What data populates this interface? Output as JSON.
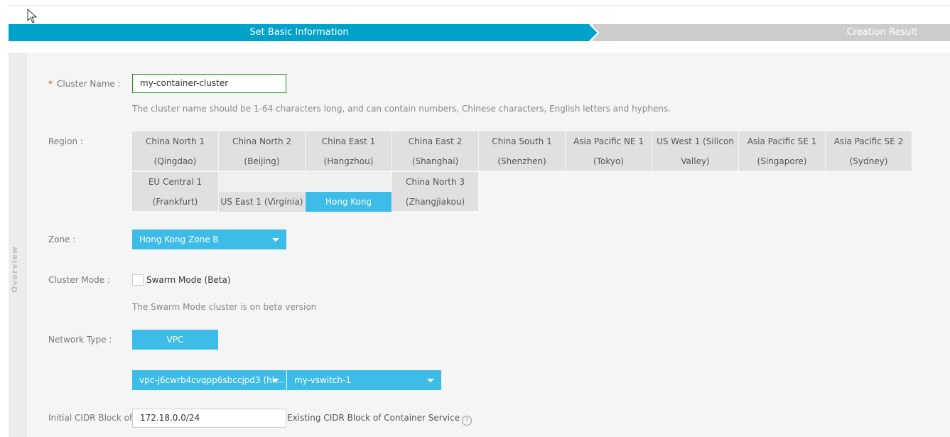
{
  "wizard": {
    "steps": [
      {
        "label": "Set Basic Information",
        "active": true
      },
      {
        "label": "Creation Result",
        "active": false
      }
    ]
  },
  "side_panel": {
    "label": "Overview"
  },
  "cluster_name": {
    "label": "Cluster Name :",
    "required_mark": "*",
    "value": "my-container-cluster",
    "hint": "The cluster name should be 1-64 characters long, and can contain numbers, Chinese characters, English letters and hyphens."
  },
  "region": {
    "label": "Region :",
    "options": [
      {
        "line1": "China North 1",
        "line2": "(Qingdao)"
      },
      {
        "line1": "China North 2",
        "line2": "(Beijing)"
      },
      {
        "line1": "China East 1",
        "line2": "(Hangzhou)"
      },
      {
        "line1": "China East 2",
        "line2": "(Shanghai)"
      },
      {
        "line1": "China South 1",
        "line2": "(Shenzhen)"
      },
      {
        "line1": "Asia Pacific NE 1",
        "line2": "(Tokyo)"
      },
      {
        "line1": "US West 1 (Silicon",
        "line2": "Valley)"
      },
      {
        "line1": "Asia Pacific SE 1",
        "line2": "(Singapore)"
      },
      {
        "line1": "Asia Pacific SE 2",
        "line2": "(Sydney)"
      },
      {
        "line1": "EU Central 1",
        "line2": "(Frankfurt)"
      },
      {
        "line1": "US East 1 (Virginia)"
      },
      {
        "line1": "Hong Kong",
        "selected": true
      },
      {
        "line1": "China North 3",
        "line2": "(Zhangjiakou)"
      }
    ]
  },
  "zone": {
    "label": "Zone :",
    "value": "Hong Kong Zone B"
  },
  "cluster_mode": {
    "label": "Cluster Mode :",
    "checkbox_label": "Swarm Mode (Beta)",
    "checked": false,
    "hint": "The Swarm Mode cluster is on beta version"
  },
  "network_type": {
    "label": "Network Type :",
    "button": "VPC",
    "vpc_select": "vpc-j6cwrb4cvqpp6sbccjpd3 (hk...",
    "vswitch_select": "my-vswitch-1"
  },
  "cidr": {
    "label": "Initial CIDR Block of C",
    "value": "172.18.0.0/24",
    "suffix": "Existing CIDR Block of Container Service",
    "help_icon": "question-circle-icon"
  },
  "colors": {
    "primary": "#00a2ca",
    "selected": "#3dbce7",
    "inactive_step": "#cccccc",
    "focus_border": "#1e8f1e"
  }
}
